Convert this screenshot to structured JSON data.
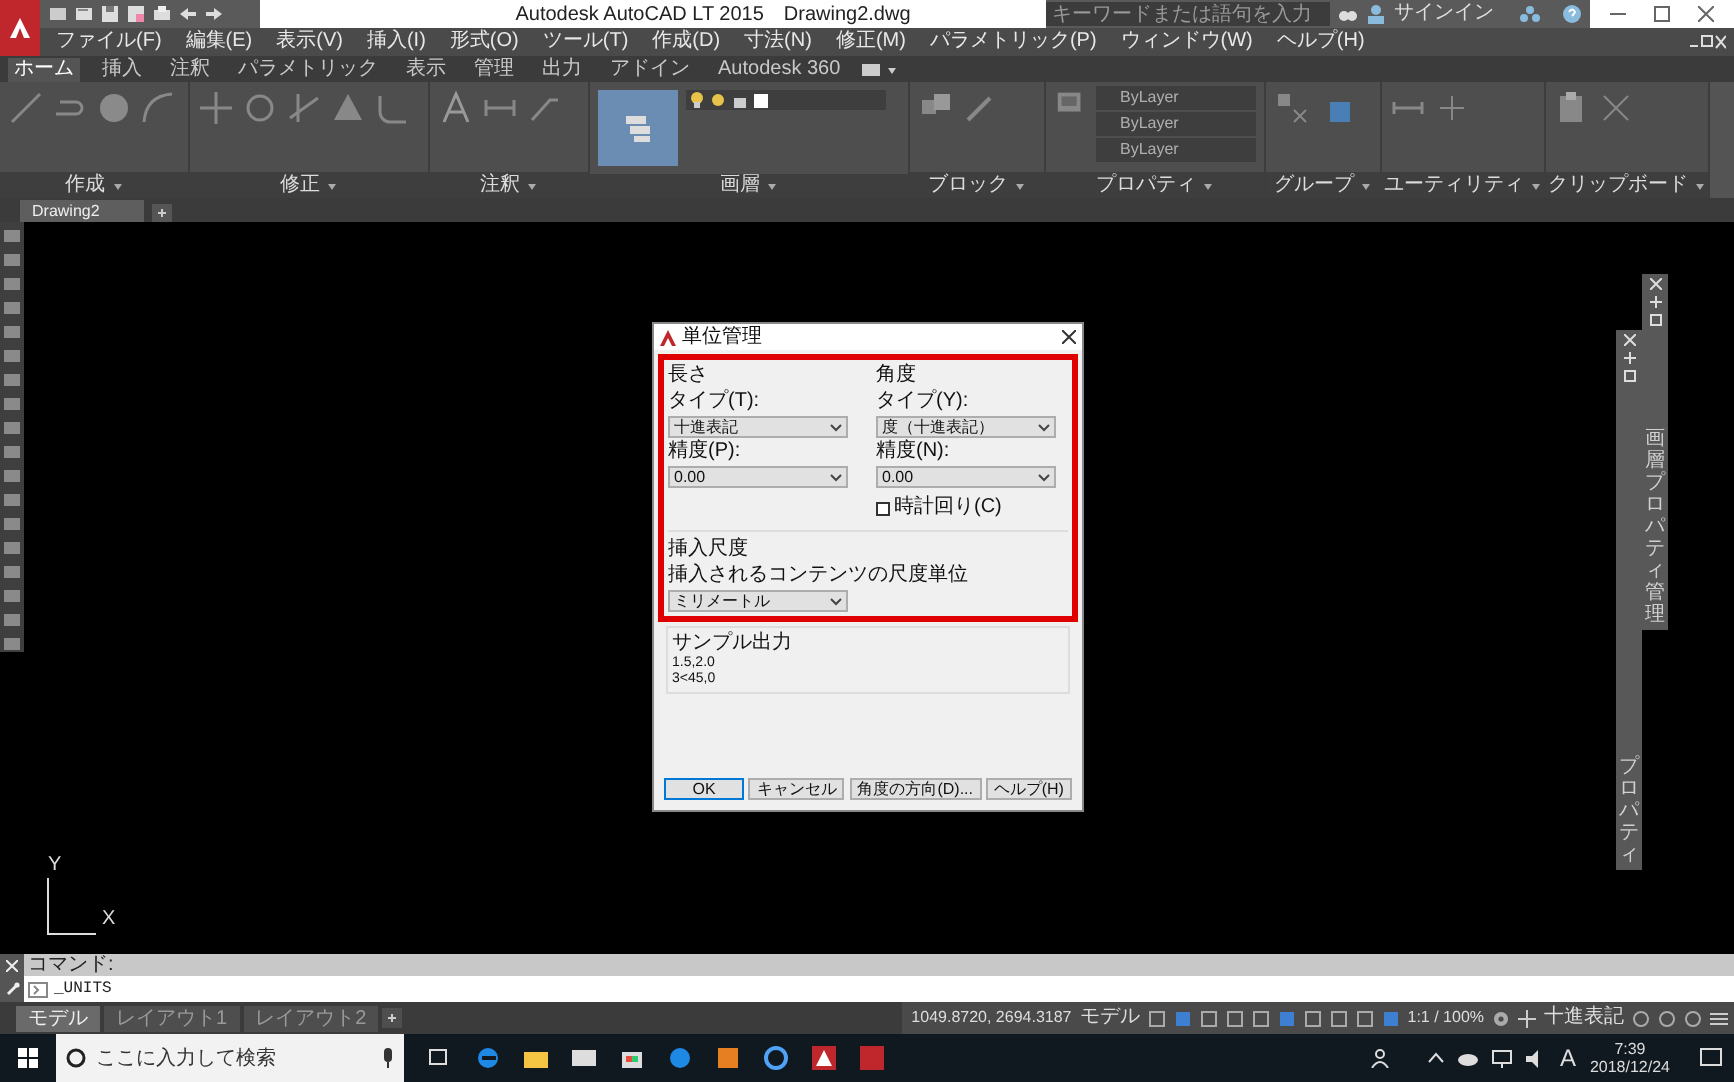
{
  "app": {
    "title": "Autodesk AutoCAD LT 2015",
    "file": "Drawing2.dwg",
    "search_placeholder": "キーワードまたは語句を入力",
    "sign_in": "サインイン"
  },
  "menu": [
    "ファイル(F)",
    "編集(E)",
    "表示(V)",
    "挿入(I)",
    "形式(O)",
    "ツール(T)",
    "作成(D)",
    "寸法(N)",
    "修正(M)",
    "パラメトリック(P)",
    "ウィンドウ(W)",
    "ヘルプ(H)"
  ],
  "ribbon_tabs": [
    {
      "label": "ホーム",
      "selected": true
    },
    {
      "label": "挿入",
      "selected": false
    },
    {
      "label": "注釈",
      "selected": false
    },
    {
      "label": "パラメトリック",
      "selected": false
    },
    {
      "label": "表示",
      "selected": false
    },
    {
      "label": "管理",
      "selected": false
    },
    {
      "label": "出力",
      "selected": false
    },
    {
      "label": "アドイン",
      "selected": false
    },
    {
      "label": "Autodesk 360",
      "selected": false
    }
  ],
  "ribbon_panels": [
    "作成",
    "修正",
    "注釈",
    "画層",
    "ブロック",
    "プロパティ",
    "グループ",
    "ユーティリティ",
    "クリップボード"
  ],
  "properties": [
    "ByLayer",
    "ByLayer",
    "ByLayer"
  ],
  "doc_tabs": [
    {
      "label": "Drawing2",
      "selected": true
    }
  ],
  "palettes": [
    "画層プロパティ管理",
    "プロパティ"
  ],
  "ucs": {
    "y": "Y",
    "x": "X"
  },
  "dialog": {
    "title": "単位管理",
    "highlight_frame": true,
    "length": {
      "heading": "長さ",
      "type_label": "タイプ(T):",
      "type_value": "十進表記",
      "precision_label": "精度(P):",
      "precision_value": "0.00"
    },
    "angle": {
      "heading": "角度",
      "type_label": "タイプ(Y):",
      "type_value": "度（十進表記）",
      "precision_label": "精度(N):",
      "precision_value": "0.00",
      "clockwise": {
        "label": "時計回り(C)",
        "checked": false
      }
    },
    "insertion": {
      "heading": "挿入尺度",
      "label": "挿入されるコンテンツの尺度単位",
      "value": "ミリメートル"
    },
    "sample": {
      "heading": "サンプル出力",
      "lines": [
        "1.5,2.0",
        "3<45,0"
      ]
    },
    "buttons": [
      {
        "label": "OK",
        "default": true
      },
      {
        "label": "キャンセル",
        "default": false
      },
      {
        "label": "角度の方向(D)...",
        "default": false
      },
      {
        "label": "ヘルプ(H)",
        "default": false
      }
    ]
  },
  "command": {
    "label": "コマンド:",
    "input": "_UNITS"
  },
  "layout_tabs": [
    {
      "label": "モデル",
      "selected": true
    },
    {
      "label": "レイアウト1",
      "selected": false
    },
    {
      "label": "レイアウト2",
      "selected": false
    }
  ],
  "status_bar": {
    "coords": "1049.8720, 2694.3187",
    "space": "モデル",
    "scale": "1:1 / 100%",
    "units": "十進表記"
  },
  "taskbar": {
    "search_placeholder": "ここに入力して検索",
    "ime": "A",
    "time": "7:39",
    "date": "2018/12/24"
  }
}
